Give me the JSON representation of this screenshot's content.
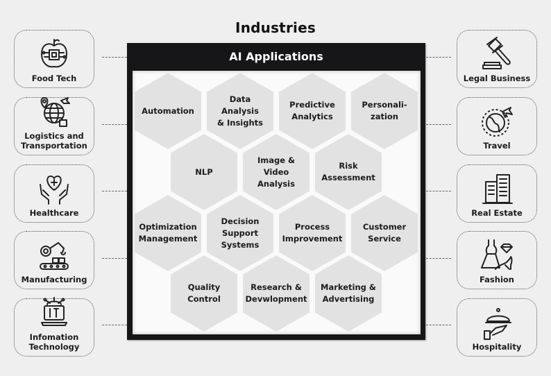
{
  "title": "Industries",
  "panel": {
    "header": "AI Applications",
    "hexagons": [
      {
        "label": "Automation"
      },
      {
        "label": "Data Analysis\n& Insights"
      },
      {
        "label": "Predictive\nAnalytics"
      },
      {
        "label": "Personali-\nzation"
      },
      {
        "label": "NLP"
      },
      {
        "label": "Image &\nVideo\nAnalysis"
      },
      {
        "label": "Risk\nAssessment"
      },
      {
        "label": "Optimization\nManagement"
      },
      {
        "label": "Decision\nSupport\nSystems"
      },
      {
        "label": "Process\nImprovement"
      },
      {
        "label": "Customer\nService"
      },
      {
        "label": "Quality\nControl"
      },
      {
        "label": "Research &\nDevwlopment"
      },
      {
        "label": "Marketing &\nAdvertising"
      }
    ]
  },
  "left_industries": [
    {
      "label": "Food Tech",
      "icon": "food-tech-icon"
    },
    {
      "label": "Logistics and\nTransportation",
      "icon": "logistics-icon"
    },
    {
      "label": "Healthcare",
      "icon": "healthcare-icon"
    },
    {
      "label": "Manufacturing",
      "icon": "manufacturing-icon"
    },
    {
      "label": "Infomation\nTechnology",
      "icon": "it-laptop-icon"
    }
  ],
  "right_industries": [
    {
      "label": "Legal Business",
      "icon": "gavel-icon"
    },
    {
      "label": "Travel",
      "icon": "travel-globe-icon"
    },
    {
      "label": "Real Estate",
      "icon": "buildings-icon"
    },
    {
      "label": "Fashion",
      "icon": "fashion-icon"
    },
    {
      "label": "Hospitality",
      "icon": "cloche-icon"
    }
  ],
  "colors": {
    "frame": "#161618",
    "hexagon": "#e2e2e3",
    "background": "#efefef"
  }
}
